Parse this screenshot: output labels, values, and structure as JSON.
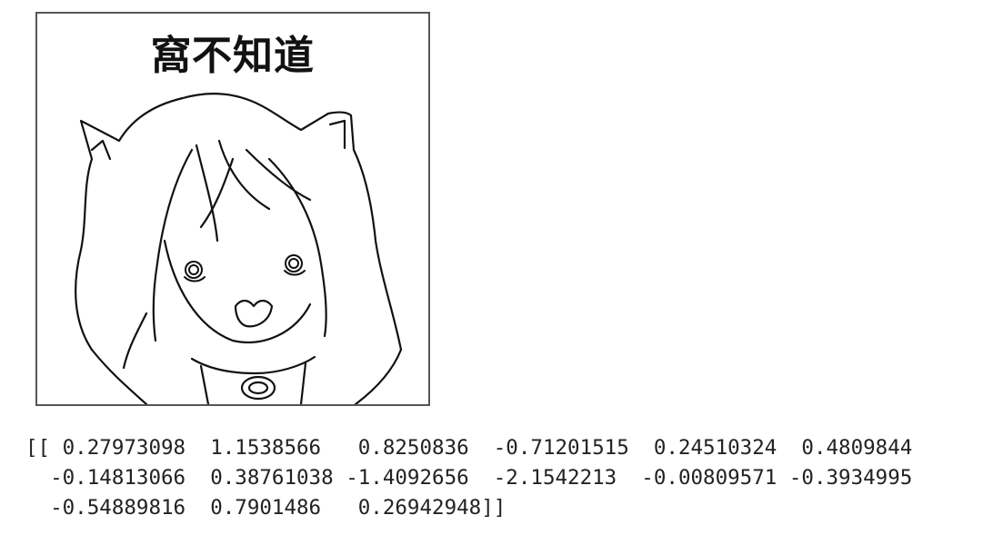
{
  "image": {
    "caption": "窩不知道"
  },
  "output": {
    "lines": [
      "[[ 0.27973098  1.1538566   0.8250836  -0.71201515  0.24510324  0.4809844",
      "  -0.14813066  0.38761038 -1.4092656  -2.1542213  -0.00809571 -0.3934995",
      "  -0.54889816  0.7901486   0.26942948]]"
    ]
  }
}
